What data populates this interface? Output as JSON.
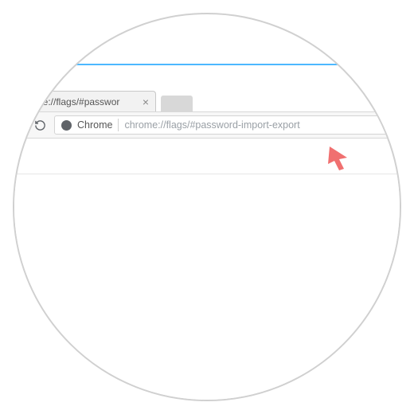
{
  "tab": {
    "title": "ne://flags/#passwor",
    "close": "×"
  },
  "omnibox": {
    "app_label": "Chrome",
    "url": "chrome://flags/#password-import-export"
  }
}
